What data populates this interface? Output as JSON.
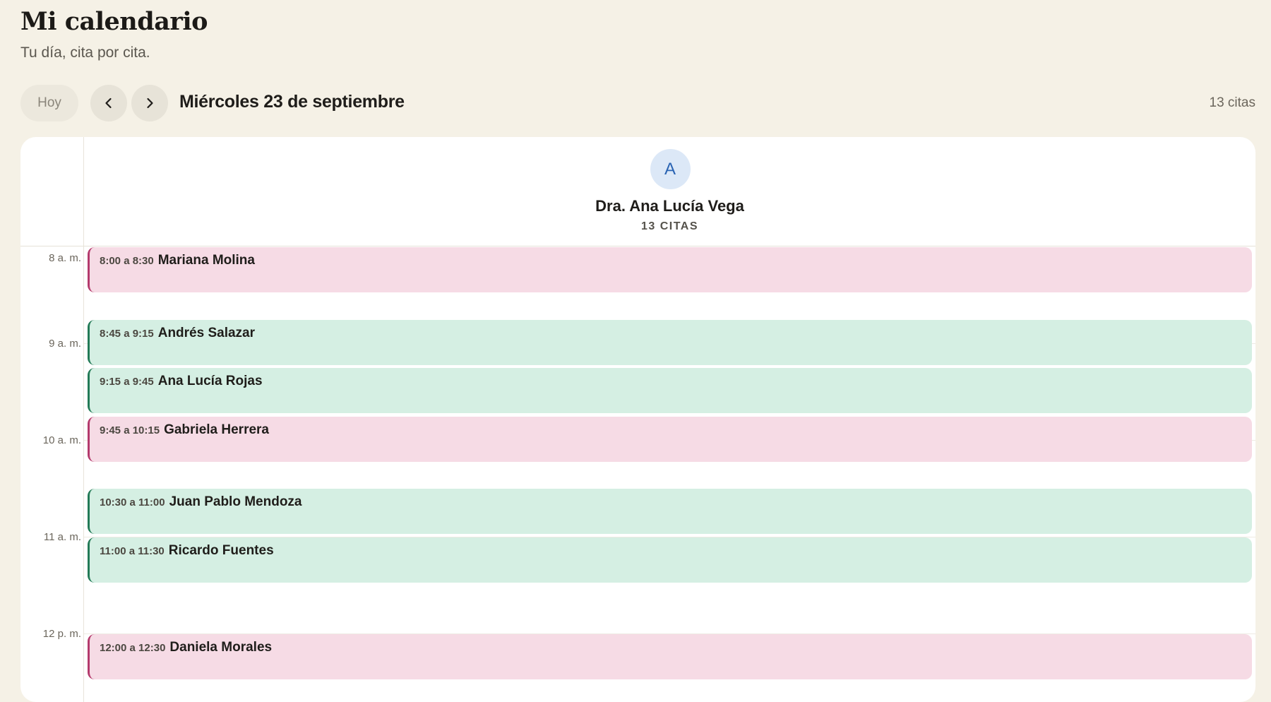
{
  "header": {
    "title": "Mi calendario",
    "subtitle": "Tu día, cita por cita."
  },
  "toolbar": {
    "today_label": "Hoy",
    "prev_icon": "chevron-left-icon",
    "next_icon": "chevron-right-icon",
    "date_label": "Miércoles 23 de septiembre",
    "count_label": "13 citas"
  },
  "doctor": {
    "avatar_initial": "A",
    "name": "Dra. Ana Lucía Vega",
    "count_label": "13 CITAS"
  },
  "colors": {
    "pink_bg": "#f6dbe5",
    "pink_accent": "#b43a6c",
    "green_bg": "#d5efe3",
    "green_accent": "#237a56",
    "avatar_bg": "#dce8f7",
    "avatar_fg": "#2a64b3"
  },
  "hours": [
    "8 a. m.",
    "9 a. m.",
    "10 a. m.",
    "11 a. m.",
    "12 p. m."
  ],
  "appointments": [
    {
      "time": "8:00 a 8:30",
      "name": "Mariana Molina",
      "color": "pink"
    },
    {
      "time": "8:45 a 9:15",
      "name": "Andrés Salazar",
      "color": "green"
    },
    {
      "time": "9:15 a 9:45",
      "name": "Ana Lucía Rojas",
      "color": "green"
    },
    {
      "time": "9:45 a 10:15",
      "name": "Gabriela Herrera",
      "color": "pink"
    },
    {
      "time": "10:30 a 11:00",
      "name": "Juan Pablo Mendoza",
      "color": "green"
    },
    {
      "time": "11:00 a 11:30",
      "name": "Ricardo Fuentes",
      "color": "green"
    },
    {
      "time": "12:00 a 12:30",
      "name": "Daniela Morales",
      "color": "pink"
    }
  ]
}
